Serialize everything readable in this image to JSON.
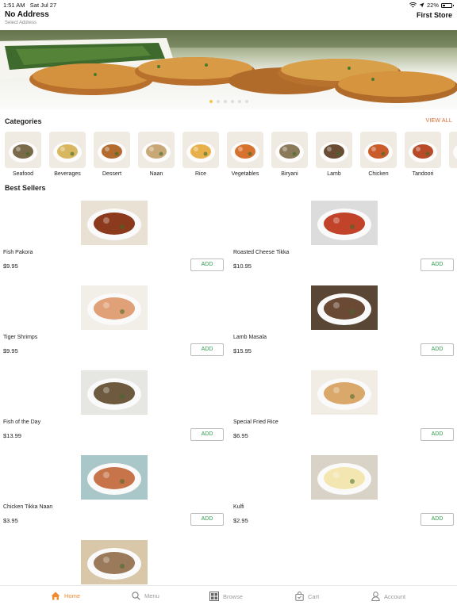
{
  "status_bar": {
    "time": "1:51 AM",
    "date": "Sat Jul 27",
    "battery": "22%"
  },
  "header": {
    "title": "No Address",
    "subtitle": "Select Address",
    "store": "First Store"
  },
  "banner": {
    "dot_count": 6,
    "active_dot": 0
  },
  "categories": {
    "title": "Categories",
    "view_all": "VIEW ALL",
    "items": [
      {
        "label": "Seafood",
        "icon": "seafood-photo",
        "color": "#7a6a4a"
      },
      {
        "label": "Beverages",
        "icon": "beverages-photo",
        "color": "#d9b760"
      },
      {
        "label": "Dessert",
        "icon": "dessert-photo",
        "color": "#b26a2e"
      },
      {
        "label": "Naan",
        "icon": "naan-photo",
        "color": "#c9a878"
      },
      {
        "label": "Rice",
        "icon": "rice-photo",
        "color": "#e8b04a"
      },
      {
        "label": "Vegetables",
        "icon": "vegetables-photo",
        "color": "#d7722e"
      },
      {
        "label": "Biryani",
        "icon": "biryani-photo",
        "color": "#8a7a5a"
      },
      {
        "label": "Lamb",
        "icon": "lamb-photo",
        "color": "#6a4c34"
      },
      {
        "label": "Chicken",
        "icon": "chicken-photo",
        "color": "#c95c2a"
      },
      {
        "label": "Tandoori",
        "icon": "tandoori-photo",
        "color": "#b84a28"
      },
      {
        "label": "A",
        "icon": "appetizer-photo",
        "color": "#d9cfc0"
      }
    ]
  },
  "best_sellers": {
    "title": "Best Sellers",
    "add_label": "ADD",
    "items": [
      {
        "name": "Fish Pakora",
        "price": "$9.95",
        "color": "#8c3a1e",
        "bg": "#e9e1d4"
      },
      {
        "name": "Roasted Cheese Tikka",
        "price": "$10.95",
        "color": "#c0432a",
        "bg": "#dcdcdc"
      },
      {
        "name": "Tiger Shrimps",
        "price": "$9.95",
        "color": "#e0a078",
        "bg": "#f2efe9"
      },
      {
        "name": "Lamb Masala",
        "price": "$15.95",
        "color": "#6b4a35",
        "bg": "#5a4634"
      },
      {
        "name": "Fish of the Day",
        "price": "$13.99",
        "color": "#6e5a3e",
        "bg": "#e6e6e2"
      },
      {
        "name": "Special Fried Rice",
        "price": "$6.95",
        "color": "#d9a86a",
        "bg": "#f1ece4"
      },
      {
        "name": "Chicken Tikka Naan",
        "price": "$3.95",
        "color": "#c7744a",
        "bg": "#a9c7c9"
      },
      {
        "name": "Kulfi",
        "price": "$2.95",
        "color": "#f3e6b0",
        "bg": "#d9d2c6"
      },
      {
        "name": "",
        "price": "",
        "color": "#9a7a5a",
        "bg": "#d8c7a8"
      }
    ]
  },
  "tabbar": {
    "items": [
      {
        "label": "Home",
        "icon": "home-icon",
        "active": true
      },
      {
        "label": "Menu",
        "icon": "search-icon",
        "active": false
      },
      {
        "label": "Browse",
        "icon": "grid-icon",
        "active": false
      },
      {
        "label": "Cart",
        "icon": "bag-icon",
        "active": false
      },
      {
        "label": "Account",
        "icon": "user-icon",
        "active": false
      }
    ],
    "active_color": "#f08a2c"
  }
}
